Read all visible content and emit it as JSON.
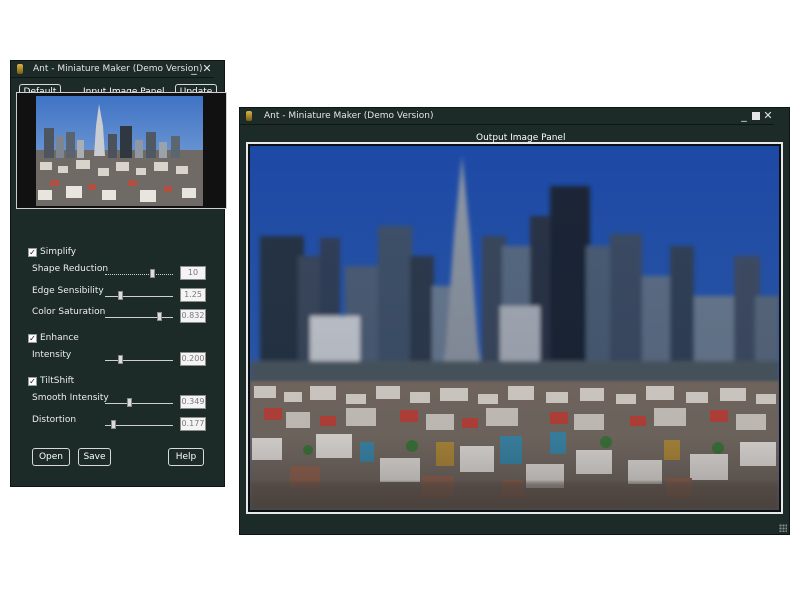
{
  "input_window": {
    "title": "Ant - Miniature Maker (Demo Version)",
    "minimize_glyph": "_",
    "close_glyph": "✕",
    "default_label": "Default",
    "panel_title": "Input Image Panel",
    "update_label": "Update",
    "simplify": {
      "label": "Simplify",
      "checked": true
    },
    "shape_reduction": {
      "label": "Shape Reduction",
      "value": "10",
      "level": 0.72
    },
    "edge_sensibility": {
      "label": "Edge Sensibility",
      "value": "1.25",
      "level": 0.2
    },
    "color_saturation": {
      "label": "Color Saturation",
      "value": "0.832",
      "level": 0.83
    },
    "enhance": {
      "label": "Enhance",
      "checked": true
    },
    "intensity": {
      "label": "Intensity",
      "value": "0.200",
      "level": 0.2
    },
    "tiltshift": {
      "label": "TiltShift",
      "checked": true
    },
    "smooth_intensity": {
      "label": "Smooth Intensity",
      "value": "0.349",
      "level": 0.35
    },
    "distortion": {
      "label": "Distortion",
      "value": "0.177",
      "level": 0.1
    },
    "open_label": "Open",
    "save_label": "Save",
    "help_label": "Help"
  },
  "output_window": {
    "title": "Ant - Miniature Maker (Demo Version)",
    "minimize_glyph": "_",
    "close_glyph": "✕",
    "panel_title": "Output Image Panel"
  },
  "colors": {
    "window_bg": "#1c2a28",
    "sky": "#1f4fa8"
  },
  "icons": [
    "app-icon",
    "minimize-icon",
    "maximize-icon",
    "close-icon",
    "checkbox-checked-icon",
    "resize-grip-icon"
  ]
}
